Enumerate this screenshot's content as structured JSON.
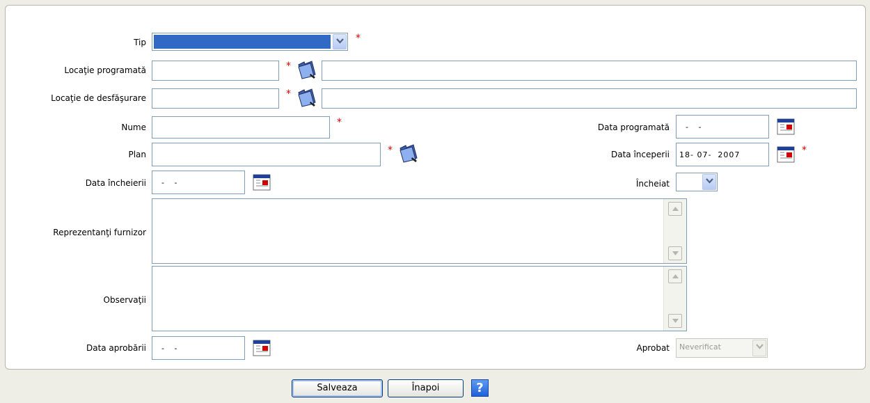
{
  "form": {
    "labels": {
      "tip": "Tip",
      "locatie_programata": "Locaţie programată",
      "locatie_desfasurare": "Locaţie de desfăşurare",
      "nume": "Nume",
      "plan": "Plan",
      "data_incheierii": "Data încheierii",
      "reprezentanti_furnizor": "Reprezentanţi furnizor",
      "observatii": "Observaţii",
      "data_aprobarii": "Data aprobării",
      "data_programata": "Data programată",
      "data_inceperii": "Data începerii",
      "incheiat": "Încheiat",
      "aprobat": "Aprobat"
    },
    "required_marker": "*",
    "values": {
      "tip": "",
      "locatie_programata_code": "",
      "locatie_programata_name": "",
      "locatie_desfasurare_code": "",
      "locatie_desfasurare_name": "",
      "nume": "",
      "plan": "",
      "data_incheierii": "  -   -",
      "data_programata": "  -   -",
      "data_inceperii": "18- 07-  2007",
      "data_aprobarii": "  -   -",
      "incheiat": "",
      "aprobat": "Neverificat",
      "reprezentanti_furnizor": "",
      "observatii": ""
    }
  },
  "buttons": {
    "save": "Salveaza",
    "back": "Înapoi",
    "help": "?"
  },
  "colors": {
    "accent": "#316ac5",
    "required": "#e00000",
    "border": "#7f9db9",
    "page_bg": "#eeeee6"
  },
  "icons": {
    "browse": "folder-icon",
    "calendar": "calendar-icon",
    "dropdown": "chevron-down-icon",
    "help": "help-icon"
  }
}
